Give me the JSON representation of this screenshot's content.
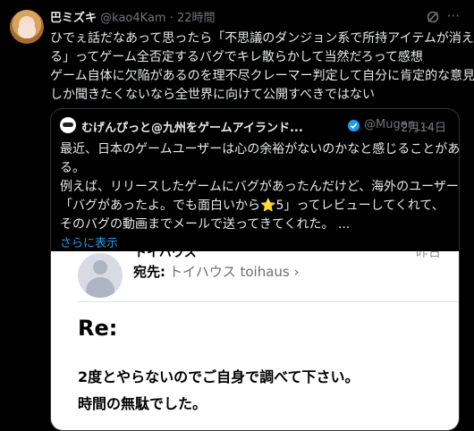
{
  "tweet": {
    "author": "巴ミズキ",
    "handle": "@kao4Kam",
    "separator": "·",
    "time": "22時間",
    "more": "···",
    "lines": [
      "ひでぇ話だなあって思ったら「不思議のダンジョン系で所持アイテムが消え",
      "る」ってゲーム全否定するバグでキレ散らかして当然だろって感想",
      "ゲーム自体に欠陥があるのを理不尽クレーマー判定して自分に肯定的な意見",
      "しか聞きたくないなら全世界に向けて公開すべきではない"
    ]
  },
  "quote": {
    "author": "むげんぴっと@九州をゲームアイランド...",
    "handle": "@Mugen_...",
    "separator": "·",
    "date": "2月14日",
    "lines": [
      "最近、日本のゲームユーザーは心の余裕がないのかなと感じることがあ",
      "る。",
      "例えば、リリースしたゲームにバグがあったんだけど、海外のユーザーは",
      "「バグがあったよ。でも面白いから"
    ],
    "star": "⭐",
    "line4_tail": "5」ってレビューしてくれて、",
    "line5": "そのバグの動画までメールで送ってきてくれた。 ...",
    "show_more": "さらに表示"
  },
  "media": {
    "sender_partial": "トイハウス",
    "right_partial": "昨日",
    "to_label": "宛先:",
    "to_value": "トイハウス toihaus ›",
    "subject": "Re:",
    "body_line1": "2度とやらないのでご自身で調べて下さい。",
    "body_line2": "時間の無駄でした。"
  }
}
